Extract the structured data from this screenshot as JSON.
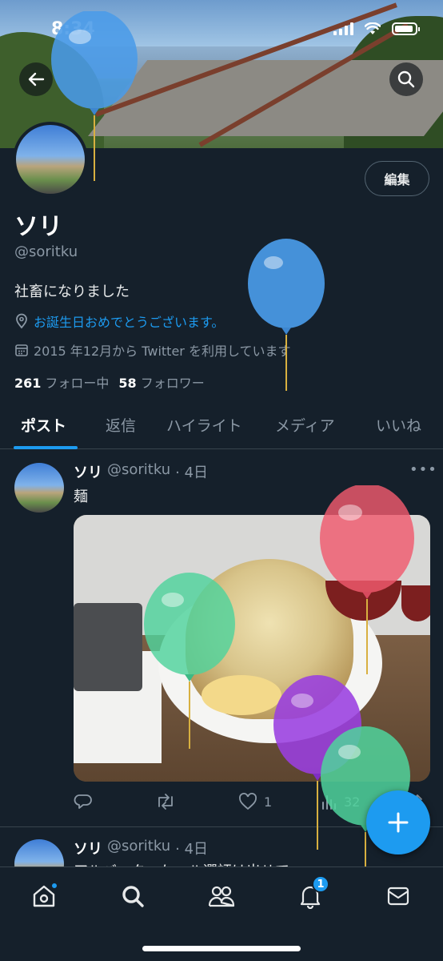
{
  "status_bar": {
    "time": "8:34"
  },
  "profile": {
    "edit_label": "編集",
    "name": "ソリ",
    "handle": "@soritku",
    "bio": "社畜になりました",
    "location": "お誕生日おめでとうございます。",
    "joined": "2015 年12月から Twitter を利用しています",
    "following_count": "261",
    "following_label": "フォロー中",
    "followers_count": "58",
    "followers_label": "フォロワー"
  },
  "tabs": [
    {
      "label": "ポスト"
    },
    {
      "label": "返信"
    },
    {
      "label": "ハイライト"
    },
    {
      "label": "メディア"
    },
    {
      "label": "いいね"
    }
  ],
  "posts": [
    {
      "name": "ソリ",
      "handle": "@soritku",
      "time": "· 4日",
      "text": "麺",
      "likes": "1",
      "views": "32"
    },
    {
      "name": "ソリ",
      "handle": "@soritku",
      "time": "· 4日",
      "text": "アルバータ・ケール選評は出せて"
    }
  ],
  "nav": {
    "notification_count": "1"
  },
  "colors": {
    "background": "#15202b",
    "accent": "#1d9bf0",
    "secondary_text": "#8b98a5"
  },
  "icons": [
    "back-arrow-icon",
    "search-icon",
    "location-pin-icon",
    "calendar-icon",
    "reply-icon",
    "retweet-icon",
    "like-icon",
    "views-icon",
    "share-icon",
    "compose-plus-icon",
    "home-icon",
    "communities-icon",
    "bell-icon",
    "mail-icon",
    "balloon-icon"
  ]
}
